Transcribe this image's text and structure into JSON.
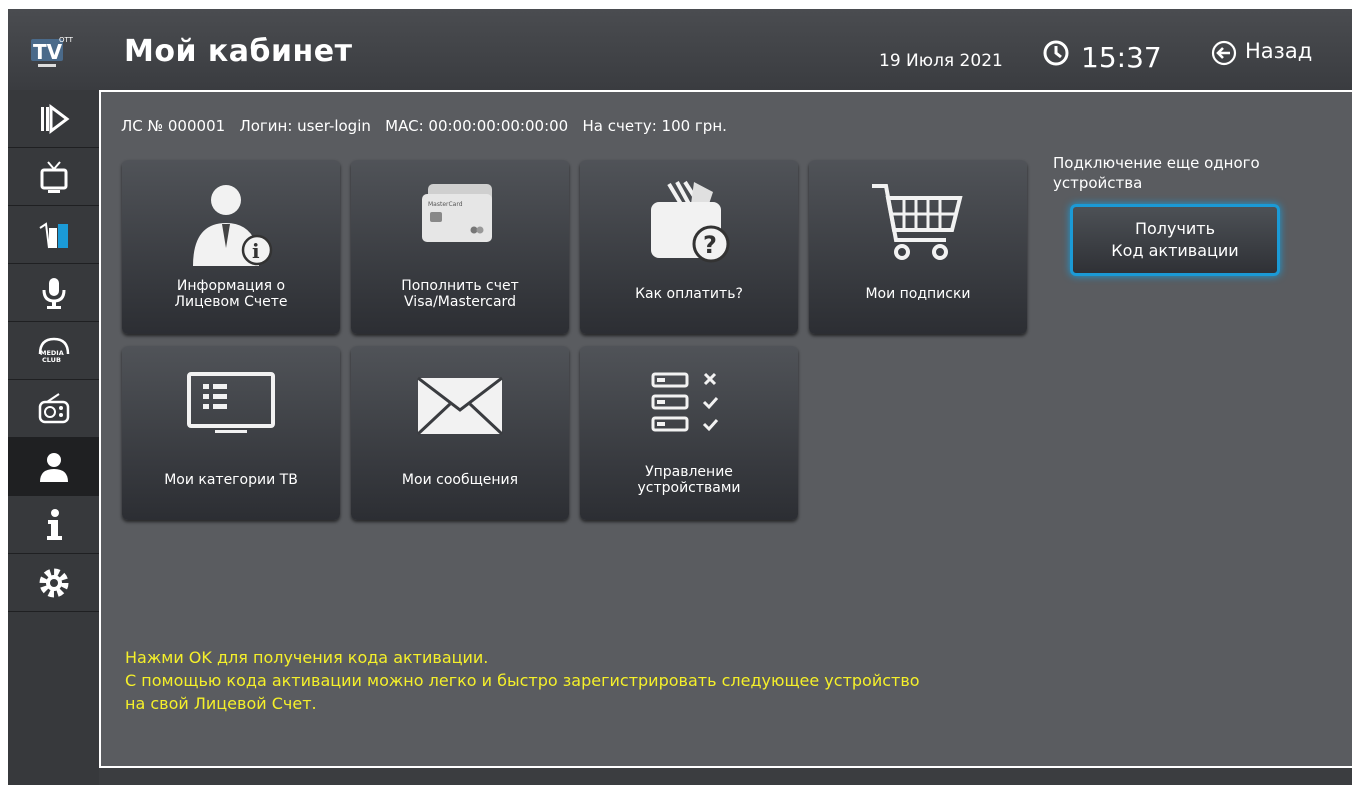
{
  "header": {
    "logo_text": "TV OTT",
    "title": "Мой кабинет",
    "date": "19 Июля 2021",
    "time": "15:37",
    "back_label": "Назад"
  },
  "sidebar": {
    "items": [
      {
        "name": "play-icon"
      },
      {
        "name": "tv-icon"
      },
      {
        "name": "drinks-icon"
      },
      {
        "name": "microphone-icon"
      },
      {
        "name": "media-club-icon",
        "text": "MEDIA CLUB"
      },
      {
        "name": "radio-icon"
      },
      {
        "name": "user-icon",
        "active": true
      },
      {
        "name": "info-icon"
      },
      {
        "name": "gear-icon"
      }
    ]
  },
  "account": {
    "info": "ЛС № 000001   Логин: user-login   MAC: 00:00:00:00:00:00   На счету: 100 грн."
  },
  "tiles": [
    {
      "label": "Информация о\nЛицевом Счете",
      "icon": "user-info-icon"
    },
    {
      "label": "Пополнить счет\nVisa/Mastercard",
      "icon": "credit-cards-icon",
      "card_text": "MasterCard"
    },
    {
      "label": "Как оплатить?",
      "icon": "wallet-question-icon"
    },
    {
      "label": "Мои подписки",
      "icon": "cart-icon"
    },
    {
      "label": "Мои категории ТВ",
      "icon": "tv-list-icon"
    },
    {
      "label": "Мои сообщения",
      "icon": "envelope-icon"
    },
    {
      "label": "Управление\nустройствами",
      "icon": "device-list-icon"
    }
  ],
  "activation": {
    "note": "Подключение еще одного устройства",
    "button_label": "Получить\nКод активации"
  },
  "hint": "Нажми OK для получения кода активации.\nС помощью кода активации можно легко и быстро зарегистрировать следующее устройство\nна свой Лицевой Счет.",
  "colors": {
    "accent": "#1b9ad6",
    "hint": "#f5f02a",
    "content_bg": "#5a5c60",
    "header_bg": "#3b3d40"
  }
}
